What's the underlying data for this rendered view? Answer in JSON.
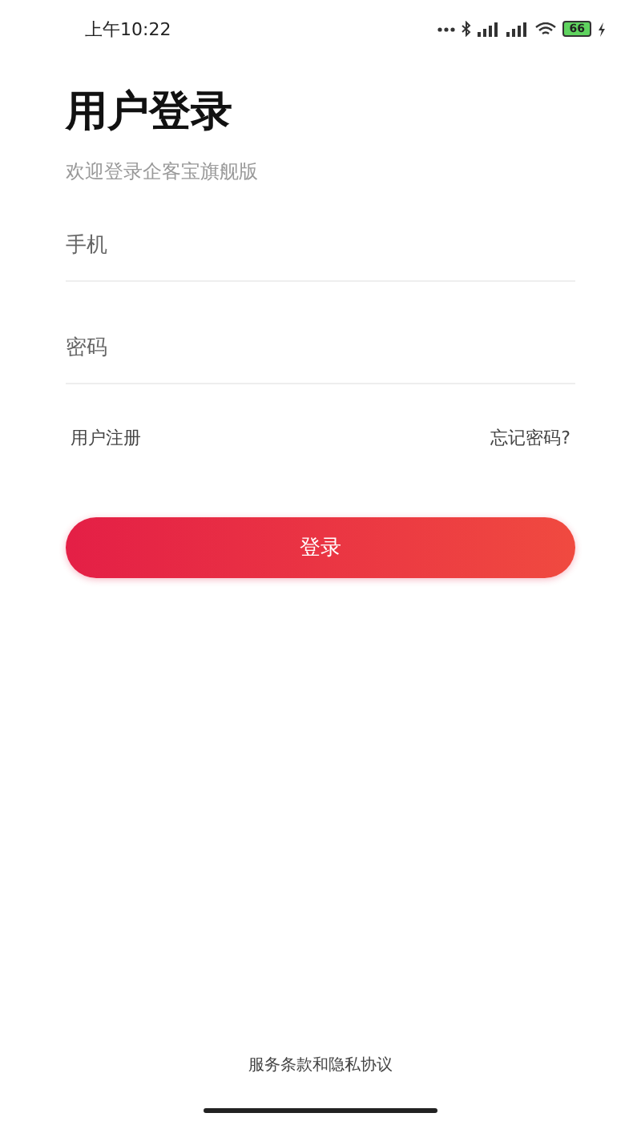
{
  "status_bar": {
    "time": "上午10:22",
    "battery": "66",
    "charging": true
  },
  "title": "用户登录",
  "subtitle": "欢迎登录企客宝旗舰版",
  "fields": [
    {
      "placeholder": "手机"
    },
    {
      "placeholder": "密码"
    }
  ],
  "links": {
    "register": "用户注册",
    "forgot": "忘记密码?"
  },
  "login_button": "登录",
  "footer": "服务条款和隐私协议"
}
